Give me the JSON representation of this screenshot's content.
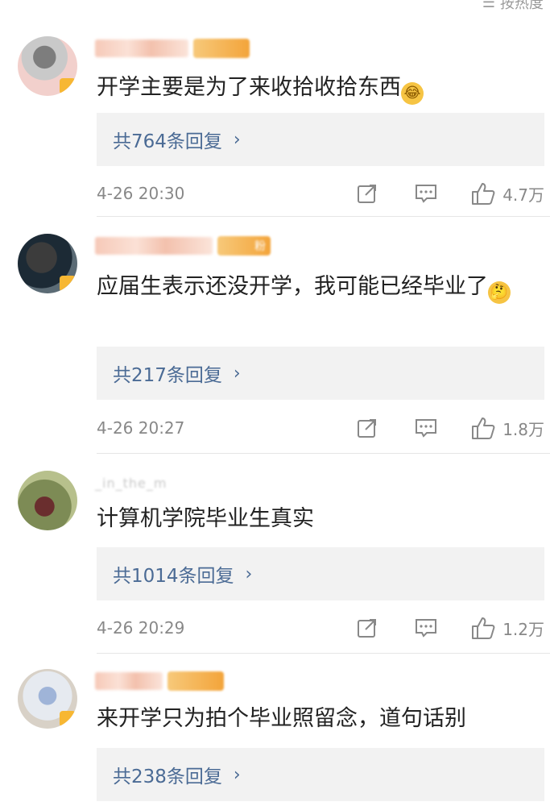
{
  "header": {
    "sort_label": "按热度",
    "sort_icon": "sort-icon"
  },
  "comments": [
    {
      "text": "开学主要是为了来收拾收拾东西",
      "emoji": "laugh-cry-emoji",
      "replies_label": "共764条回复",
      "time": "4-26 20:30",
      "likes": "4.7万"
    },
    {
      "text": "应届生表示还没开学，我可能已经毕业了",
      "emoji": "thinking-emoji",
      "tag_text": "粉",
      "replies_label": "共217条回复",
      "time": "4-26 20:27",
      "likes": "1.8万"
    },
    {
      "name_fragment": "_in_the_m",
      "text": "计算机学院毕业生真实",
      "replies_label": "共1014条回复",
      "time": "4-26 20:29",
      "likes": "1.2万"
    },
    {
      "text": "来开学只为拍个毕业照留念，道句话别",
      "replies_label": "共238条回复"
    }
  ]
}
